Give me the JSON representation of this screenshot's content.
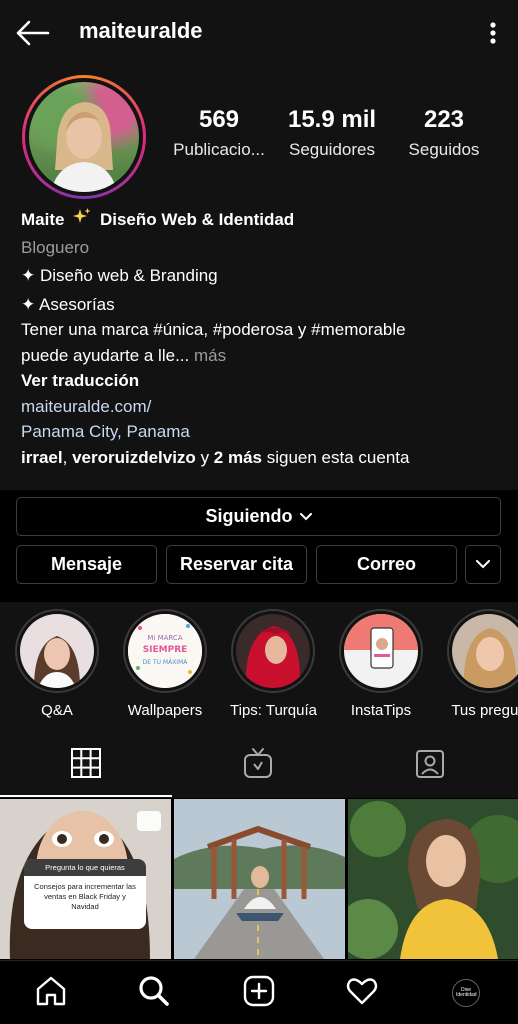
{
  "header": {
    "username": "maiteuralde"
  },
  "stats": [
    {
      "value": "569",
      "label": "Publicacio..."
    },
    {
      "value": "15.9 mil",
      "label": "Seguidores"
    },
    {
      "value": "223",
      "label": "Seguidos"
    }
  ],
  "bio": {
    "name_prefix": "Maite",
    "name_suffix": "Diseño Web & Identidad",
    "category": "Bloguero",
    "line1": "✦ Diseño web & Branding",
    "line2": "✦ Asesorías",
    "line3": "Tener una marca #única, #poderosa y #memorable",
    "line4": "puede ayudarte a lle...",
    "more": "más",
    "translate": "Ver traducción",
    "website": "maiteuralde.com/",
    "location": "Panama City, Panama",
    "followers_user1": "irrael",
    "followers_sep": ",",
    "followers_user2": "veroruizdelvizo",
    "followers_and": "y",
    "followers_more": "2 más",
    "followers_text": "siguen esta cuenta"
  },
  "buttons": {
    "following": "Siguiendo",
    "message": "Mensaje",
    "book": "Reservar cita",
    "email": "Correo"
  },
  "highlights": [
    {
      "label": "Q&A"
    },
    {
      "label": "Wallpapers"
    },
    {
      "label": "Tips: Turquía"
    },
    {
      "label": "InstaTips"
    },
    {
      "label": "Tus pregun"
    }
  ],
  "posts": {
    "question_title": "Pregunta lo que quieras",
    "question_answer": "Consejos para incrementar las ventas en Black Friday y Navidad"
  },
  "wallpaper_text": "Mi MARCA SIEMPRE DE TU MÁXIMA",
  "nav_avatar_text": "Dise Identidad",
  "colors": {
    "background": "#121212",
    "accent_ring": "#dd2a7b",
    "link": "#c9d9f0",
    "muted": "#9c9c9c"
  },
  "icons": [
    "back-arrow-icon",
    "more-vertical-icon",
    "chevron-down-icon",
    "grid-icon",
    "igtv-icon",
    "tagged-icon",
    "home-icon",
    "search-icon",
    "add-icon",
    "heart-icon"
  ]
}
